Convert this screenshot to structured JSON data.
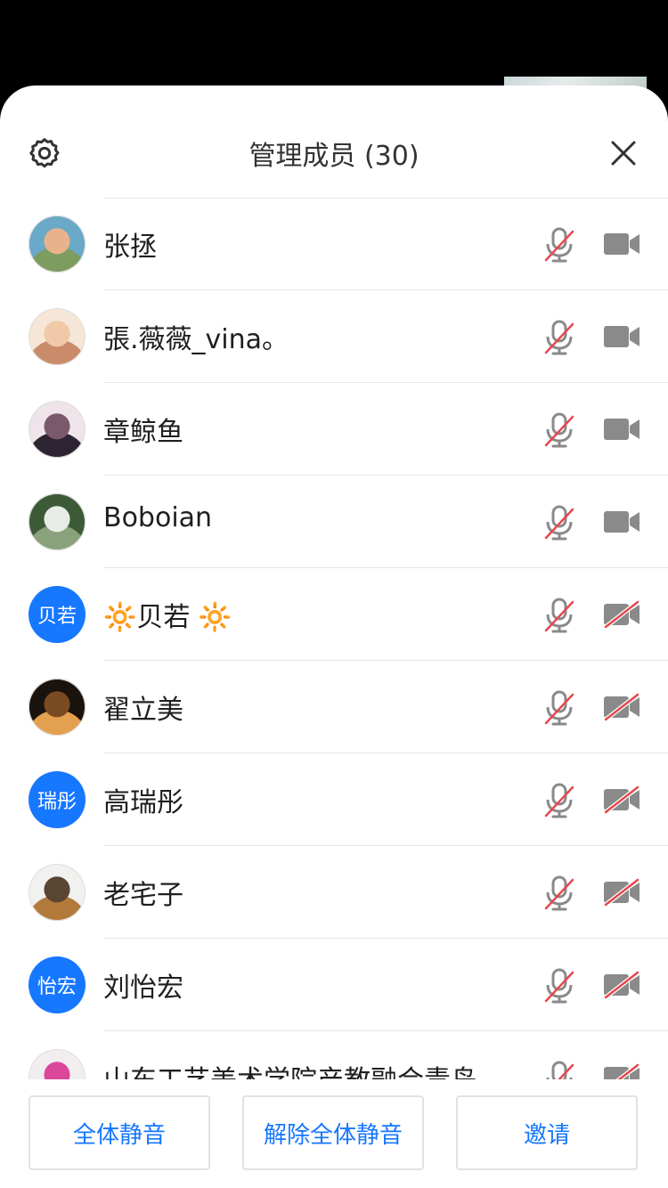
{
  "header": {
    "title": "管理成员 (30)"
  },
  "members": [
    {
      "name": "张拯",
      "avatar": "photo",
      "avatar_colors": [
        "#6aa9c7",
        "#e8b38a",
        "#7d9c5f"
      ],
      "cam_muted": false
    },
    {
      "name": "張.薇薇_vina。",
      "avatar": "photo",
      "avatar_colors": [
        "#f5e6d8",
        "#f0c9a8",
        "#c98b6a"
      ],
      "cam_muted": false
    },
    {
      "name": "章鲸鱼",
      "avatar": "photo",
      "avatar_colors": [
        "#efe4ea",
        "#7a5a6a",
        "#2c2430"
      ],
      "cam_muted": false
    },
    {
      "name": "Boboian",
      "avatar": "photo",
      "avatar_colors": [
        "#3d5a36",
        "#e8ece6",
        "#8aa27c"
      ],
      "cam_muted": false
    },
    {
      "name": "🔆贝若 🔆",
      "avatar": "text",
      "avatar_text": "贝若",
      "cam_muted": true
    },
    {
      "name": "翟立美",
      "avatar": "photo",
      "avatar_colors": [
        "#1a120c",
        "#7a4a22",
        "#e3a050"
      ],
      "cam_muted": true
    },
    {
      "name": "高瑞彤",
      "avatar": "text",
      "avatar_text": "瑞彤",
      "cam_muted": true
    },
    {
      "name": "老宅子",
      "avatar": "photo",
      "avatar_colors": [
        "#f1f1ef",
        "#5a4432",
        "#b27a3a"
      ],
      "cam_muted": true
    },
    {
      "name": "刘怡宏",
      "avatar": "text",
      "avatar_text": "怡宏",
      "cam_muted": true
    },
    {
      "name": "山东工艺美术学院产教融合青岛",
      "avatar": "photo",
      "avatar_colors": [
        "#f2eef0",
        "#d9489b",
        "#3a2a2a"
      ],
      "cam_muted": true
    }
  ],
  "footer": {
    "mute_all": "全体静音",
    "unmute_all": "解除全体静音",
    "invite": "邀请"
  },
  "colors": {
    "accent": "#1677ff",
    "icon_gray": "#8a8a8a",
    "muted_red": "#e5484d"
  }
}
